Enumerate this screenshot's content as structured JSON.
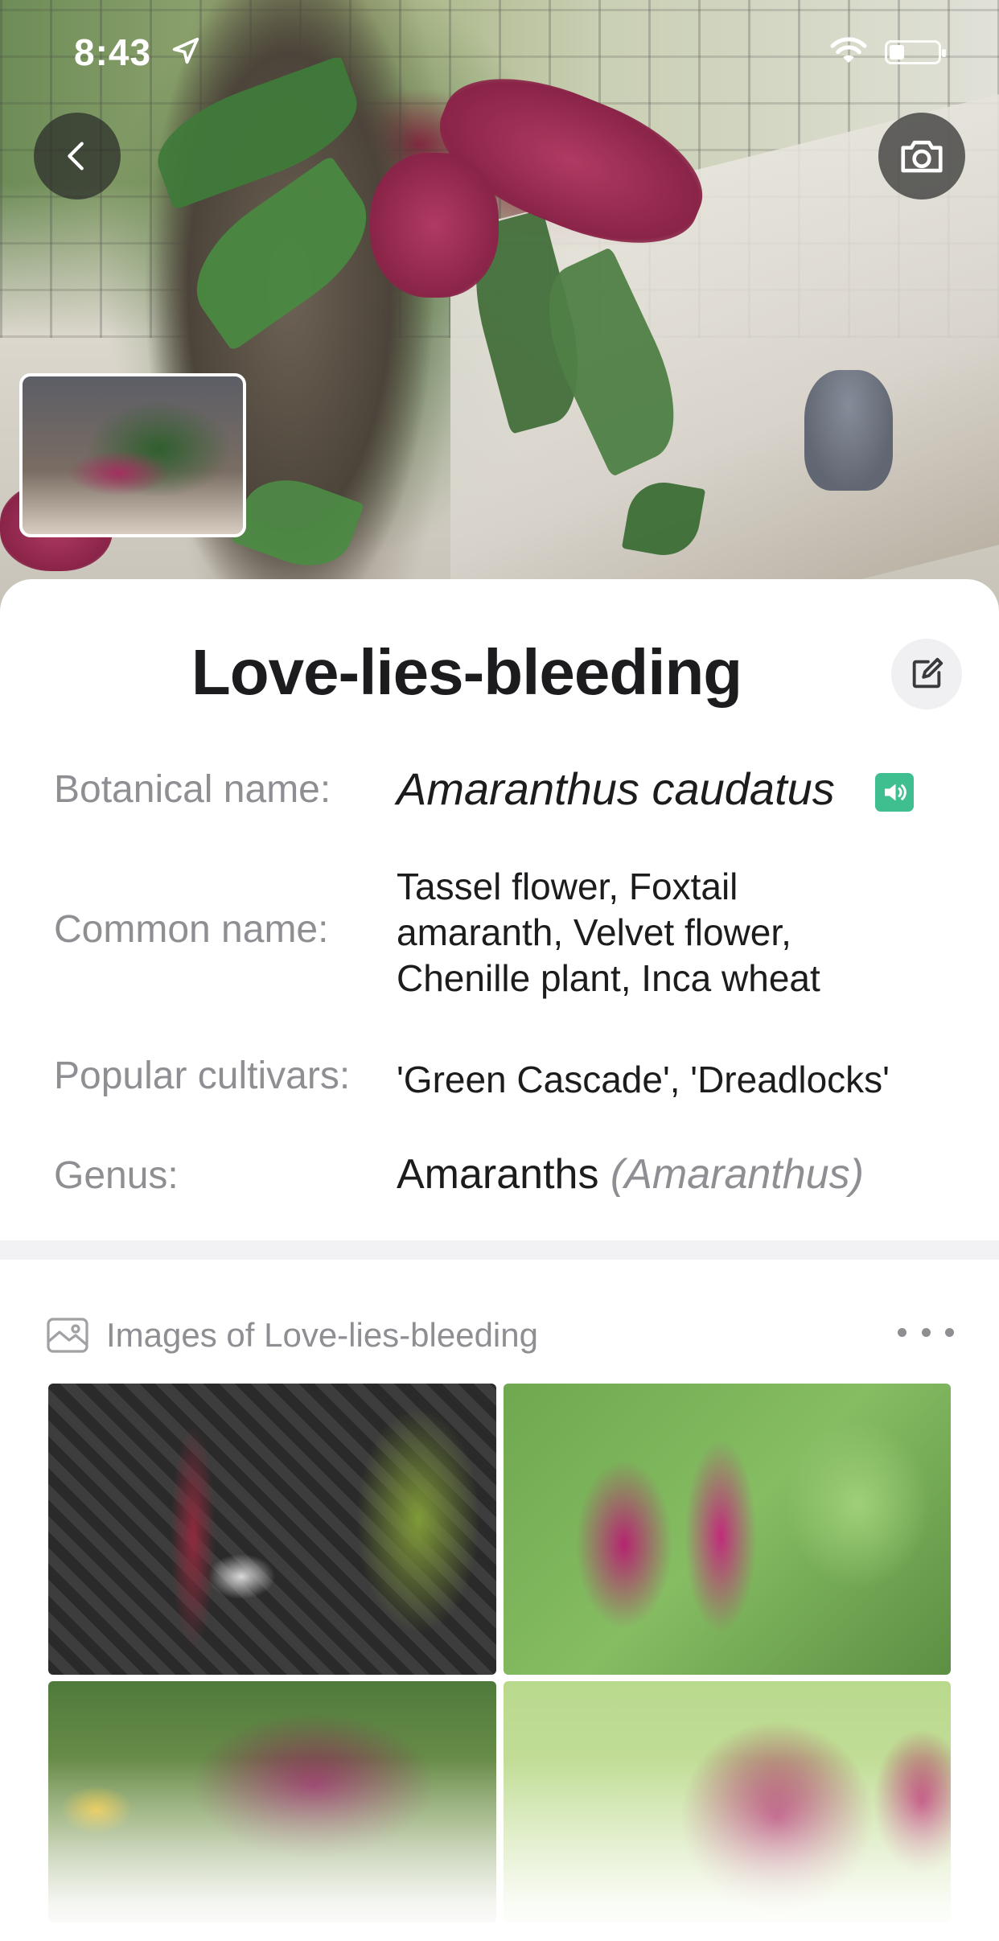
{
  "status_bar": {
    "time": "8:43"
  },
  "hero": {
    "back_icon": "chevron-left-icon",
    "camera_icon": "camera-icon"
  },
  "plant": {
    "title": "Love-lies-bleeding",
    "edit_icon": "edit-icon",
    "rows": {
      "botanical": {
        "label": "Botanical name:",
        "value": "Amaranthus caudatus"
      },
      "common": {
        "label": "Common name:",
        "value": "Tassel flower, Foxtail amaranth, Velvet flower, Chenille plant, Inca wheat"
      },
      "cultivars": {
        "label": "Popular cultivars:",
        "value": "'Green Cascade', 'Dreadlocks'"
      },
      "genus": {
        "label": "Genus:",
        "value": "Amaranths",
        "latin": "(Amaranthus)"
      }
    }
  },
  "images": {
    "title": "Images of Love-lies-bleeding",
    "icon": "images-icon",
    "more_icon": "more-horizontal-icon"
  },
  "colors": {
    "accent_speaker": "#3fbf8f",
    "label_gray": "#8e8e93",
    "text_dark": "#1c1c1e"
  }
}
